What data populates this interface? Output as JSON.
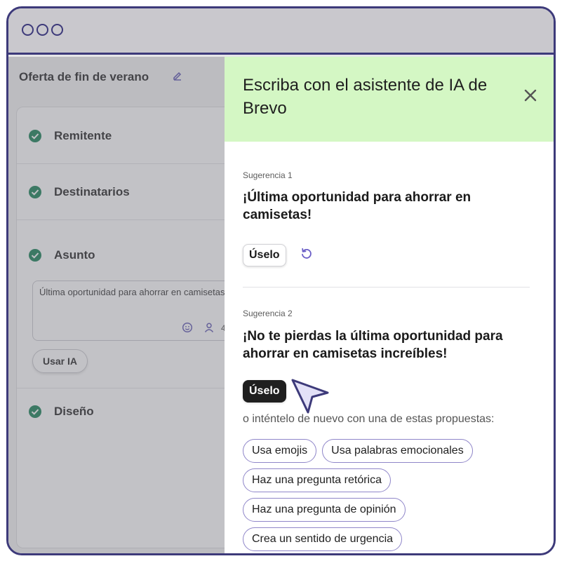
{
  "window": {
    "controls": [
      "window-dot",
      "window-dot",
      "window-dot"
    ]
  },
  "page": {
    "campaign_title": "Oferta de fin de verano",
    "steps": [
      {
        "label": "Remitente"
      },
      {
        "label": "Destinatarios"
      },
      {
        "label": "Asunto"
      },
      {
        "label": "Diseño"
      }
    ],
    "subject": {
      "value": "Última oportunidad para ahorrar en camisetas",
      "count": "4"
    },
    "ai_button_label": "Usar IA"
  },
  "panel": {
    "title": "Escriba con el asistente de IA de Brevo",
    "suggestions": [
      {
        "label": "Sugerencia 1",
        "text": "¡Última oportunidad para ahorrar en camisetas!",
        "use_label": "Úselo"
      },
      {
        "label": "Sugerencia 2",
        "text": "¡No te pierdas la última oportunidad para ahorrar en camisetas increíbles!",
        "use_label": "Úselo"
      }
    ],
    "retry_text": "o inténtelo de nuevo con una de estas propuestas:",
    "proposals": [
      [
        "Usa emojis",
        "Usa palabras emocionales"
      ],
      [
        "Haz una pregunta retórica"
      ],
      [
        "Haz una pregunta de opinión"
      ],
      [
        "Crea un sentido de urgencia"
      ]
    ]
  },
  "colors": {
    "frame": "#3d3a7a",
    "header_bg": "#d4f7c4",
    "check": "#0b7a4e",
    "accent": "#6b5fc7"
  },
  "icons": [
    "edit-icon",
    "check-icon",
    "emoji-icon",
    "person-icon",
    "close-icon",
    "regenerate-icon",
    "cursor-icon"
  ]
}
